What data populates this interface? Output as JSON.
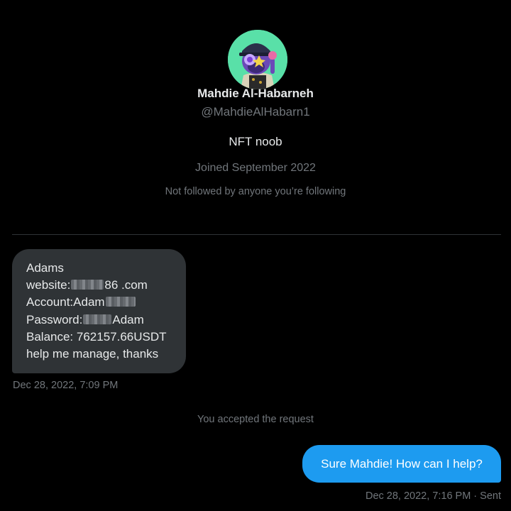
{
  "profile": {
    "avatar": "nft-avatar",
    "name": "Mahdie Al-Habarneh",
    "handle": "@MahdieAlHabarn1",
    "bio": "NFT noob",
    "joined": "Joined September 2022",
    "followers_note": "Not followed by anyone you’re following"
  },
  "messages": {
    "incoming": {
      "line1": "Adams",
      "line2_prefix": "website:",
      "line2_suffix": "86 .com",
      "line3_prefix": "Account:Adam",
      "line4_prefix": "Password:",
      "line4_suffix": "Adam",
      "line5": "Balance: 762157.66USDT",
      "line6": "help me manage, thanks",
      "timestamp": "Dec 28, 2022, 7:09 PM"
    },
    "system_note": "You accepted the request",
    "outgoing": {
      "text": "Sure Mahdie! How can I help?",
      "timestamp": "Dec 28, 2022, 7:16 PM · Sent"
    }
  },
  "colors": {
    "background": "#000000",
    "incoming_bubble": "#2f3336",
    "outgoing_bubble": "#1d9bf0",
    "secondary_text": "#71767b",
    "avatar_background": "#59e0a8"
  }
}
